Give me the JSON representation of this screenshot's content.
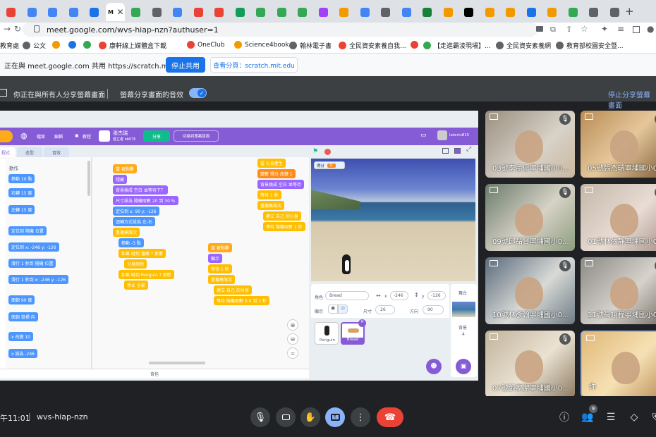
{
  "browser": {
    "tabs": [
      {
        "color": "#ea4335"
      },
      {
        "color": "#4285f4"
      },
      {
        "color": "#4285f4"
      },
      {
        "color": "#4285f4"
      },
      {
        "color": "#1a73e8"
      },
      {
        "label": "M",
        "active": true
      },
      {
        "color": "#34a853"
      },
      {
        "color": "#5f6368"
      },
      {
        "color": "#4285f4"
      },
      {
        "color": "#ea4335"
      },
      {
        "color": "#ea4335"
      },
      {
        "color": "#0f9d58"
      },
      {
        "color": "#34a853"
      },
      {
        "color": "#34a853"
      },
      {
        "color": "#34a853"
      },
      {
        "color": "#a142f4"
      },
      {
        "color": "#f29900"
      },
      {
        "color": "#4285f4"
      },
      {
        "color": "#5f6368"
      },
      {
        "color": "#4285f4"
      },
      {
        "color": "#188038"
      },
      {
        "color": "#f29900"
      },
      {
        "color": "#000000"
      },
      {
        "color": "#f29900"
      },
      {
        "color": "#f29900"
      },
      {
        "color": "#1a73e8"
      },
      {
        "color": "#f29900"
      },
      {
        "color": "#34a853"
      },
      {
        "color": "#5f6368"
      },
      {
        "color": "#5f6368"
      }
    ],
    "new_tab": "+",
    "url": "meet.google.com/wvs-hiap-nzn?authuser=1",
    "bookmarks": [
      "教育處",
      "公文",
      "",
      "",
      "",
      "康軒線上媒體盒下載",
      "OneClub",
      "Science4book",
      "翰林電子書",
      "全民資安素養自我...",
      "",
      "【走進霸淩現場】...",
      "全民資安素養網",
      "教育部校園安全暨..."
    ]
  },
  "chrome_share": {
    "message": "正在與 meet.google.com 共用 https://scratch.mit.edu",
    "stop_label": "停止共用",
    "view_tab_label": "查看分頁：scratch.mit.edu"
  },
  "meet_banner": {
    "presenting_text": "你正在與所有人分享螢幕畫面",
    "audio_label": "螢幕分享畫面的音效",
    "stop_share": "停止分享螢幕畫面"
  },
  "scratch": {
    "menu": [
      "檔案",
      "編輯",
      "教程"
    ],
    "project_title": "張杰瑞",
    "author": "建立者 nb076",
    "share_btn": "分享",
    "see_project": "切換到專案頁面",
    "username": "laterin815",
    "tabs": [
      "程式",
      "造型",
      "音效"
    ],
    "category": "動作",
    "palette_blocks": [
      "移動 10 點",
      "右轉 15 度",
      "左轉 15 度",
      "定位到 隨機 位置",
      "定位到 x: -246 y: -126",
      "滑行 1 秒到 隨機 位置",
      "滑行 1 秒到 x: -246 y: -126",
      "面朝 90 度",
      "面朝 鼠標 向",
      "x 改變 10",
      "x 設為 -246"
    ],
    "scripts": {
      "s1": [
        "當 被點擊",
        "隱藏",
        "背景換成 空白 並等待下？",
        "尺寸設為 隨機取數 20 到 30 %",
        "定位到 x: 90 y: -126",
        "迴轉方式設為 左-右",
        "重複無限次",
        "移動 -3 點",
        "如果 碰到 邊緣 ? 那麼",
        "分身刪除",
        "如果 碰到 Penguin ? 那麼",
        "停止 全部"
      ],
      "s2": [
        "當 被點擊",
        "顯示",
        "等待 1 秒",
        "重複無限次",
        "建立 自己 的分身",
        "等待 隨機取數 0.5 到 3 秒"
      ],
      "s3": [
        "當 分身產生",
        "變數 得分 改變 1",
        "背景換成 空白 並等待",
        "等待 1 秒",
        "重複無限次",
        "建立 自己 的分身",
        "等待 隨機取數 1 秒"
      ]
    },
    "backpack": "背包",
    "stage_var_label": "得分",
    "stage_var_value": "0",
    "sprite": {
      "label": "角色",
      "name": "Bread",
      "x_label": "x",
      "x": "-246",
      "y_label": "y",
      "y": "-126",
      "show_label": "顯示",
      "size_label": "尺寸",
      "size": "26",
      "dir_label": "方向",
      "dir": "90"
    },
    "sprites": [
      "Penguin",
      "Bread"
    ],
    "stage_label": "舞台",
    "backdrop_label": "背景",
    "backdrop_count": "4"
  },
  "participants": [
    {
      "name": "03號李孟恩寧埔國小0...",
      "muted": true
    },
    {
      "name": "05號張杰瑞寧埔國小0...",
      "muted": true
    },
    {
      "name": "09號邱品賢寧埔國小0...",
      "muted": true
    },
    {
      "name": "01號林依靜寧埔國小0...",
      "muted": true
    },
    {
      "name": "10號林彥翰寧埔國小0...",
      "muted": true
    },
    {
      "name": "11號高翊程寧埔國小0...",
      "muted": true
    },
    {
      "name": "07號張家潔寧埔國小0...",
      "muted": true
    },
    {
      "name": "你",
      "muted": false
    }
  ],
  "bottom": {
    "time": "午11:01",
    "separator": "|",
    "code": "wvs-hiap-nzn",
    "people_count": "9"
  },
  "colors": {
    "meet_dark": "#202124",
    "leave_red": "#ea4335",
    "scratch_purple": "#855cd6",
    "share_blue": "#1a73e8",
    "present_blue": "#8ab4f8"
  }
}
